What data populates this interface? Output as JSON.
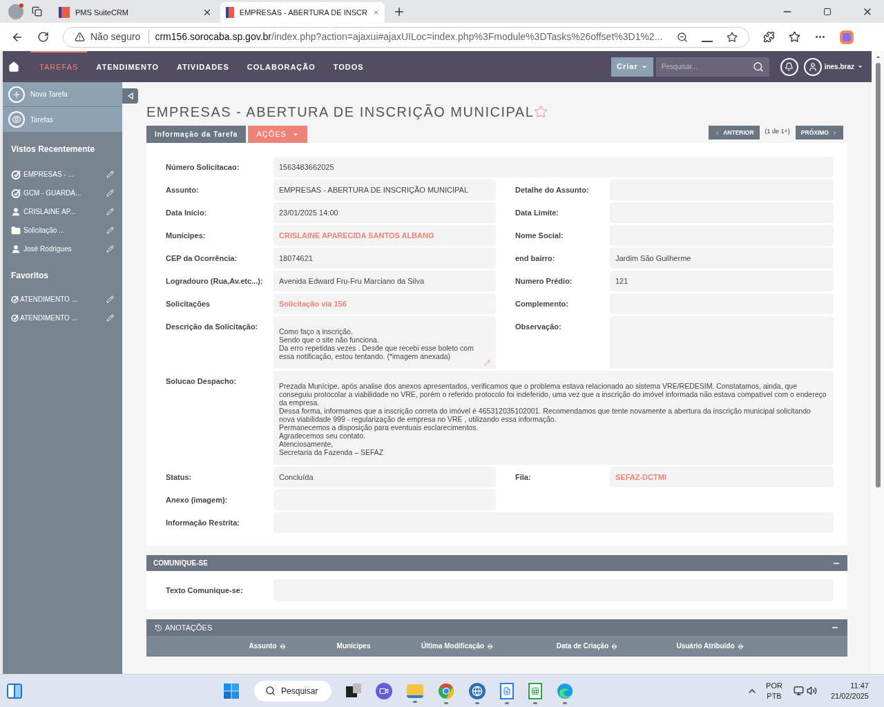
{
  "browser": {
    "tabs": [
      {
        "title": "PMS SuiteCRM",
        "selected": false
      },
      {
        "title": "EMPRESAS - ABERTURA DE INSCR",
        "selected": true
      }
    ],
    "security": "Não seguro",
    "url_host": "crm156.sorocaba.sp.gov.br",
    "url_rest": "/index.php?action=ajaxui#ajaxUILoc=index.php%3Fmodule%3DTasks%26offset%3D1%2..."
  },
  "nav": {
    "items": [
      {
        "label": "TAREFAS",
        "selected": true
      },
      {
        "label": "ATENDIMENTO",
        "selected": false
      },
      {
        "label": "ATIVIDADES",
        "selected": false
      },
      {
        "label": "COLABORAÇÃO",
        "selected": false
      },
      {
        "label": "TODOS",
        "selected": false
      }
    ],
    "create_button": "Criar",
    "search_placeholder": "Pesquisar...",
    "user": "ines.braz"
  },
  "sidebar": {
    "actions": [
      {
        "label": "Nova Tarefa",
        "kind": "add"
      },
      {
        "label": "Tarefas",
        "kind": "view"
      }
    ],
    "recent_title": "Vistos Recentemente",
    "recent": [
      {
        "label": "EMPRESAS - ...",
        "kind": "task"
      },
      {
        "label": "GCM - GUARDA...",
        "kind": "task"
      },
      {
        "label": "CRISLAINE AP...",
        "kind": "person"
      },
      {
        "label": "Solicitação ...",
        "kind": "folder"
      },
      {
        "label": "José Rodrigues",
        "kind": "person"
      }
    ],
    "favorites_title": "Favoritos",
    "favorites": [
      {
        "label": "ATENDIMENTO ..."
      },
      {
        "label": "ATENDIMENTO ..."
      }
    ]
  },
  "record": {
    "title": "EMPRESAS - ABERTURA DE INSCRIÇÃO MUNICIPAL",
    "favorite": false,
    "detail_tab": "Informação da Tarefa",
    "actions_button": "AÇÕES",
    "pager": {
      "previous": "ANTERIOR",
      "count": "(1 de 1+)",
      "next": "PRÓXIMO"
    },
    "rows": [
      {
        "label": "Número Solicitacao:",
        "value": "1563483662025",
        "full": true
      },
      {
        "label": "Assunto:",
        "value": "EMPRESAS - ABERTURA DE INSCRIÇÃO MUNICIPAL",
        "right": {
          "label": "Detalhe do Assunto:"
        }
      },
      {
        "label": "Data Início:",
        "value": "23/01/2025 14:00",
        "right": {
          "label": "Data Limite:"
        }
      },
      {
        "label": "Munícipes:",
        "value": "CRISLAINE APARECIDA SANTOS ALBANO",
        "link": true,
        "right": {
          "label": "Nome Social:"
        }
      },
      {
        "label": "CEP da Ocorrência:",
        "value": "18074621",
        "right": {
          "label": "end bairro:",
          "value": "Jardim São Guilherme"
        }
      },
      {
        "label": "Logradouro (Rua,Av.etc...):",
        "value": "Avenida Edward Fru-Fru Marciano da Silva",
        "right": {
          "label": "Numero Prédio:",
          "value": "121"
        }
      },
      {
        "label": "Solicitações",
        "value": "Solicitação via 156",
        "link": true,
        "right": {
          "label": "Complemento:"
        }
      },
      {
        "label": "Descrição da Solicitação:",
        "kind": "multiline",
        "editable": true,
        "lines": [
          "Como faço a inscrição.",
          "Sendo que o site não funciona.",
          "Da erro repetidas vezes . Desde que recebi esse boleto com essa notificação, estou tentando. (*imagem anexada)"
        ],
        "right": {
          "label": "Observação:"
        }
      },
      {
        "label": "Solucao Despacho:",
        "kind": "multiline",
        "full": true,
        "lines": [
          "Prezada Munícipe, após analise dos anexos apresentados, verificamos que o problema estava relacionado ao sistema VRE/REDESIM. Constatamos, ainda, que conseguiu protocolar a viabilidade no VRE, porém o referido protocolo foi indeferido, uma vez que a inscrição do imóvel informada não estava compatível com o endereço da empresa.",
          "Dessa forma, informamos que a inscrição correta do imóvel é 465312035102001. Recomendamos que tente novamente a abertura da inscrição municipal solicitando nova viabilidade 999 - regularização de empresa no VRE , utilizando essa informação.",
          "Permanecemos a disposição para eventuais esclarecimentos.",
          "Agradecemos seu contato.",
          "Atenciosamente,",
          "Secretaria da Fazenda – SEFAZ"
        ]
      },
      {
        "label": "Status:",
        "value": "Concluída",
        "right": {
          "label": "Fila:",
          "value": "SEFAZ-DCTMI",
          "link": true
        }
      },
      {
        "label": "Anexo (imagem):"
      },
      {
        "label": "Informação Restrita:",
        "full": true
      }
    ]
  },
  "comunique": {
    "title": "COMUNIQUE-SE",
    "field_label": "Texto Comunique-se:"
  },
  "anotacoes": {
    "title": "ANOTAÇÕES",
    "columns": [
      {
        "label": "Assunto",
        "sortable": true
      },
      {
        "label": "Munícipes",
        "sortable": false
      },
      {
        "label": "Última Modificação",
        "sortable": true
      },
      {
        "label": "Data de Criação",
        "sortable": true
      },
      {
        "label": "Usuário Atribuído",
        "sortable": true
      }
    ]
  },
  "taskbar": {
    "search": "Pesquisar",
    "apps": [
      {
        "kind": "widgets",
        "running": false
      },
      {
        "kind": "start",
        "running": false
      },
      {
        "kind": "search",
        "running": false
      },
      {
        "kind": "taskview",
        "running": false
      },
      {
        "kind": "chat",
        "running": false
      },
      {
        "kind": "files",
        "running": true
      },
      {
        "kind": "chrome",
        "running": true
      },
      {
        "kind": "mail",
        "running": true
      },
      {
        "kind": "writer",
        "running": true
      },
      {
        "kind": "calc",
        "running": true
      },
      {
        "kind": "edge",
        "running": true
      }
    ],
    "lang": "POR",
    "layout": "PTB",
    "time": "11:47",
    "date": "21/02/2025"
  }
}
